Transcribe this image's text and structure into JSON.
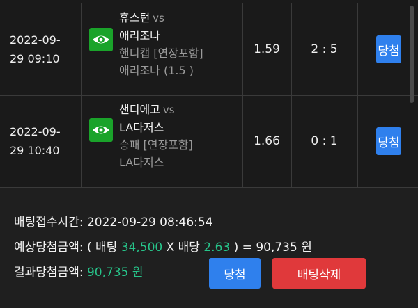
{
  "bets": [
    {
      "date_line1": "2022-09-",
      "date_line2": "29 09:10",
      "home": "휴스턴",
      "vs": "vs",
      "away": "애리조나",
      "market": "핸디캡 [연장포함]",
      "pick": "애리조나 (1.5 )",
      "odds": "1.59",
      "score": "2 : 5",
      "result": "당첨"
    },
    {
      "date_line1": "2022-09-",
      "date_line2": "29 10:40",
      "home": "샌디에고",
      "vs": "vs",
      "away": "LA다저스",
      "market": "승패 [연장포함]",
      "pick": "LA다저스",
      "odds": "1.66",
      "score": "0 : 1",
      "result": "당첨"
    }
  ],
  "summary": {
    "bet_time_label": "배팅접수시간:",
    "bet_time": "2022-09-29 08:46:54",
    "expected_label": "예상당첨금액:",
    "expected_open": "( 배팅",
    "stake": "34,500",
    "times": "X",
    "odds_label": "배당",
    "total_odds": "2.63",
    "expected_close": ") =",
    "expected_amount": "90,735 원",
    "result_label": "결과당첨금액:",
    "result_amount": "90,735 원"
  },
  "buttons": {
    "win": "당첨",
    "delete": "배팅삭제"
  },
  "colors": {
    "eye_button": "#1aa32a",
    "result_button": "#2f80ed",
    "delete_button": "#e0393b",
    "highlight": "#27c48a"
  }
}
